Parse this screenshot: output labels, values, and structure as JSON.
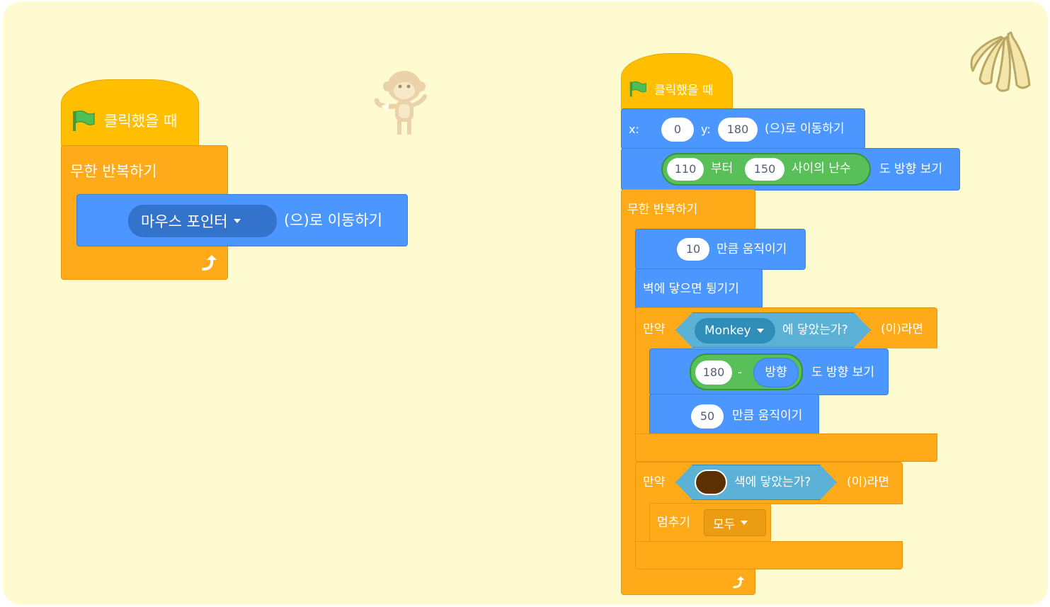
{
  "left_script": {
    "hat_label": "클릭했을 때",
    "forever_label": "무한 반복하기",
    "goto_dropdown": "마우스 포인터",
    "goto_suffix": "(으)로 이동하기"
  },
  "right_script": {
    "hat_label": "클릭했을 때",
    "gotoxy": {
      "x_label": "x:",
      "x_value": "0",
      "y_label": "y:",
      "y_value": "180",
      "suffix": "(으)로 이동하기"
    },
    "point_random": {
      "from": "110",
      "from_label": "부터",
      "to": "150",
      "to_label": "사이의 난수",
      "suffix": "도 방향 보기"
    },
    "forever_label": "무한 반복하기",
    "move1": {
      "value": "10",
      "suffix": "만큼 움직이기"
    },
    "bounce_label": "벽에 닿으면 튕기기",
    "if1": {
      "prefix": "만약",
      "touching_dropdown": "Monkey",
      "touching_suffix": "에 닿았는가?",
      "suffix": "(이)라면",
      "point_dir": {
        "a": "180",
        "minus": "-",
        "b": "방향",
        "suffix": "도 방향 보기"
      },
      "move": {
        "value": "50",
        "suffix": "만큼 움직이기"
      }
    },
    "if2": {
      "prefix": "만약",
      "color": "#5c3000",
      "color_suffix": "색에 닿았는가?",
      "suffix": "(이)라면",
      "stop_label": "멈추기",
      "stop_dropdown": "모두"
    }
  },
  "icons": [
    "green-flag-icon",
    "loop-arrow-icon",
    "monkey-sprite",
    "bananas-sprite"
  ],
  "colors": {
    "stage_bg": "#fffbd0",
    "events": "#ffbf00",
    "control": "#ffab19",
    "motion": "#4c97ff",
    "operators": "#59c059",
    "sensing": "#5cb1d6"
  }
}
